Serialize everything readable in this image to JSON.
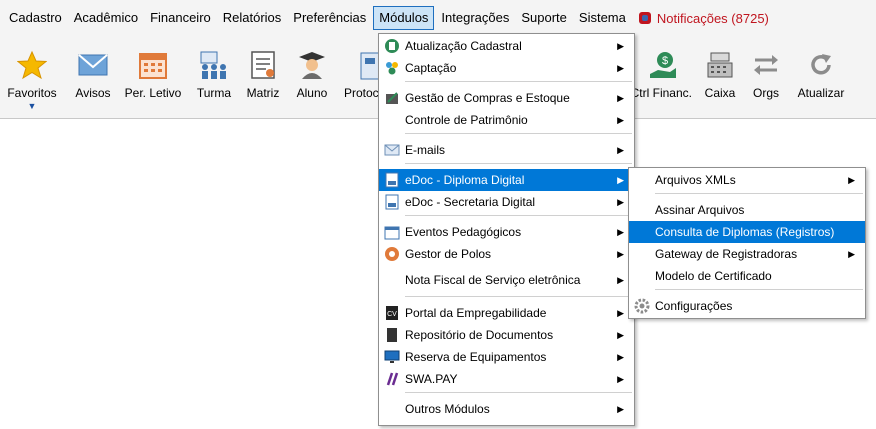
{
  "menubar": {
    "items": [
      "Cadastro",
      "Acadêmico",
      "Financeiro",
      "Relatórios",
      "Preferências",
      "Módulos",
      "Integrações",
      "Suporte",
      "Sistema"
    ],
    "active": "Módulos",
    "notifications": "Notificações (8725)"
  },
  "toolbar": {
    "favoritos": "Favoritos",
    "avisos": "Avisos",
    "periodo": "Per. Letivo",
    "turma": "Turma",
    "matriz": "Matriz",
    "aluno": "Aluno",
    "protocolo": "Protoc",
    "ctrl_financ": "Ctrl Financ.",
    "caixa": "Caixa",
    "orgs": "Orgs",
    "atualizar": "Atualizar"
  },
  "modulos_menu": {
    "items": [
      {
        "label": "Atualização Cadastral",
        "icon": "cadastral-icon"
      },
      {
        "label": "Captação",
        "icon": "captacao-icon"
      },
      {
        "label": "Gestão de Compras e Estoque",
        "icon": "compras-icon"
      },
      {
        "label": "Controle de Patrimônio",
        "icon": ""
      },
      {
        "label": "E-mails",
        "icon": "email-icon"
      },
      {
        "label": "eDoc - Diploma Digital",
        "icon": "doc-icon"
      },
      {
        "label": "eDoc - Secretaria Digital",
        "icon": "doc-icon"
      },
      {
        "label": "Eventos Pedagógicos",
        "icon": "calendar-icon"
      },
      {
        "label": "Gestor de Polos",
        "icon": "polos-icon"
      },
      {
        "label": "Nota Fiscal de Serviço eletrônica",
        "icon": ""
      },
      {
        "label": "Portal da Empregabilidade",
        "icon": "cv-icon"
      },
      {
        "label": "Repositório de Documentos",
        "icon": "repositorio-icon"
      },
      {
        "label": "Reserva de Equipamentos",
        "icon": "monitor-icon"
      },
      {
        "label": "SWA.PAY",
        "icon": "swapay-icon"
      },
      {
        "label": "Outros Módulos",
        "icon": ""
      }
    ]
  },
  "edoc_submenu": {
    "items": [
      {
        "label": "Arquivos XMLs"
      },
      {
        "label": "Assinar Arquivos"
      },
      {
        "label": "Consulta de Diplomas (Registros)"
      },
      {
        "label": "Gateway de Registradoras"
      },
      {
        "label": "Modelo de Certificado"
      },
      {
        "label": "Configurações"
      }
    ]
  },
  "colors": {
    "highlight": "#0078d7",
    "hover": "#cce4f7",
    "notification": "#c0151f",
    "toolbar_bg": "#f4f4f4"
  }
}
